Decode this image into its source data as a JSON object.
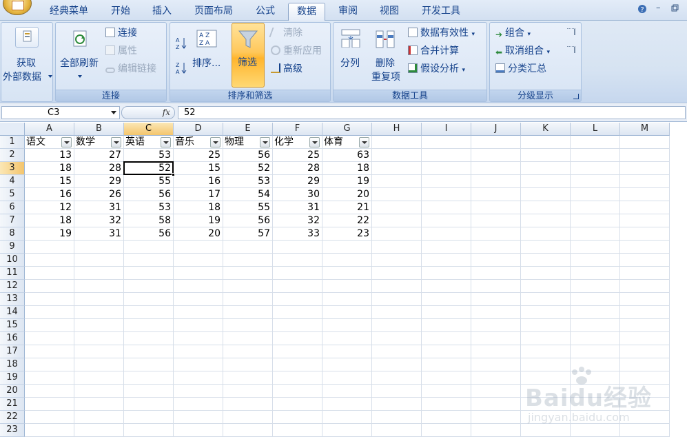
{
  "tabs": [
    {
      "label": "经典菜单"
    },
    {
      "label": "开始"
    },
    {
      "label": "插入"
    },
    {
      "label": "页面布局"
    },
    {
      "label": "公式"
    },
    {
      "label": "数据"
    },
    {
      "label": "审阅"
    },
    {
      "label": "视图"
    },
    {
      "label": "开发工具"
    }
  ],
  "ribbon": {
    "get_external": {
      "line1": "获取",
      "line2": "外部数据"
    },
    "connections_group": {
      "label": "连接",
      "refresh_all": "全部刷新",
      "connections": "连接",
      "properties": "属性",
      "edit_links": "编辑链接"
    },
    "sort_filter_group": {
      "label": "排序和筛选",
      "sort": "排序...",
      "filter": "筛选",
      "clear": "清除",
      "reapply": "重新应用",
      "advanced": "高级"
    },
    "data_tools_group": {
      "label": "数据工具",
      "text_to_columns": "分列",
      "remove_dup_1": "删除",
      "remove_dup_2": "重复项",
      "validation": "数据有效性",
      "consolidate": "合并计算",
      "what_if": "假设分析"
    },
    "outline_group": {
      "label": "分级显示",
      "group": "组合",
      "ungroup": "取消组合",
      "subtotal": "分类汇总"
    }
  },
  "formula_bar": {
    "name_box": "C3",
    "fx": "fx",
    "value": "52"
  },
  "columns": [
    "A",
    "B",
    "C",
    "D",
    "E",
    "F",
    "G",
    "H",
    "I",
    "J",
    "K",
    "L",
    "M"
  ],
  "rows": [
    "1",
    "2",
    "3",
    "4",
    "5",
    "6",
    "7",
    "8",
    "9",
    "10",
    "11",
    "12",
    "13",
    "14",
    "15",
    "16",
    "17",
    "18",
    "19",
    "20",
    "21",
    "22",
    "23"
  ],
  "table": {
    "headers": [
      "语文",
      "数学",
      "英语",
      "音乐",
      "物理",
      "化学",
      "体育"
    ],
    "rows": [
      [
        "13",
        "27",
        "53",
        "25",
        "56",
        "25",
        "63"
      ],
      [
        "18",
        "28",
        "52",
        "15",
        "52",
        "28",
        "18"
      ],
      [
        "15",
        "29",
        "55",
        "16",
        "53",
        "29",
        "19"
      ],
      [
        "16",
        "26",
        "56",
        "17",
        "54",
        "30",
        "20"
      ],
      [
        "12",
        "31",
        "53",
        "18",
        "55",
        "31",
        "21"
      ],
      [
        "18",
        "32",
        "58",
        "19",
        "56",
        "32",
        "22"
      ],
      [
        "19",
        "31",
        "56",
        "20",
        "57",
        "33",
        "23"
      ]
    ]
  },
  "selection": {
    "cell": "C3"
  },
  "watermark": {
    "brand": "Baidu经验",
    "url": "jingyan.baidu.com"
  }
}
